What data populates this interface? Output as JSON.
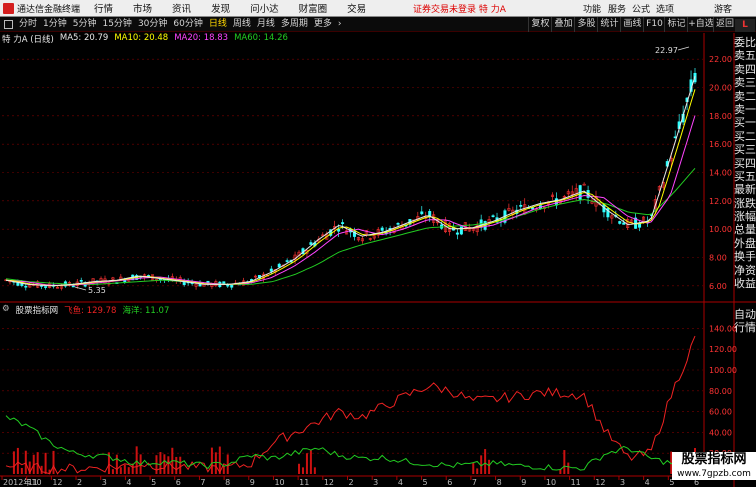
{
  "menubar": {
    "app_name": "通达信金融终端",
    "menus": [
      "行情",
      "市场",
      "资讯",
      "发现",
      "问小达",
      "财富圈",
      "交易"
    ],
    "notice": "证券交易未登录  特 力A",
    "right": [
      "功能",
      "服务",
      "公式",
      "选项",
      "游客"
    ]
  },
  "toolbar": {
    "periods": [
      "分时",
      "1分钟",
      "5分钟",
      "15分钟",
      "30分钟",
      "60分钟",
      "日线",
      "周线",
      "月线",
      "多周期",
      "更多"
    ],
    "selected": "日线",
    "right_buttons": [
      "复权",
      "叠加",
      "多股",
      "统计",
      "画线",
      "F10",
      "标记",
      "+自选",
      "返回"
    ]
  },
  "main_indicator": {
    "title": "特 力A (日线)",
    "ma": [
      {
        "label": "MA5: 20.79",
        "color": "#e8e8e8"
      },
      {
        "label": "MA10: 20.48",
        "color": "#ffff00"
      },
      {
        "label": "MA20: 18.83",
        "color": "#ff44ff"
      },
      {
        "label": "MA60: 14.26",
        "color": "#22cc22"
      }
    ]
  },
  "sub_indicator": {
    "name": "股票指标网",
    "values": [
      {
        "label": "飞鱼: 129.78",
        "color": "#ee2222"
      },
      {
        "label": "海洋: 11.07",
        "color": "#22cc22"
      }
    ]
  },
  "price_axis": [
    "22.00",
    "20.00",
    "18.00",
    "16.00",
    "14.00",
    "12.00",
    "10.00",
    "8.00",
    "6.00"
  ],
  "price_annotations": {
    "high": "22.97",
    "low": "5.35"
  },
  "sub_axis": [
    "140.00",
    "120.00",
    "100.00",
    "80.00",
    "60.00",
    "40.00",
    "20.00"
  ],
  "date_labels": [
    "2012年10",
    "11",
    "12",
    "2",
    "3",
    "4",
    "5",
    "6",
    "7",
    "8",
    "9",
    "10",
    "11",
    "12",
    "2",
    "3",
    "4",
    "5",
    "6",
    "7",
    "8",
    "9",
    "10",
    "11",
    "12",
    "3",
    "4",
    "5",
    "6"
  ],
  "side_tabs_top": [
    "委比",
    "卖五",
    "卖四",
    "卖三",
    "卖二",
    "卖一",
    "买一",
    "买二",
    "买三",
    "买四",
    "买五",
    "最新",
    "涨跌",
    "涨幅",
    "总量",
    "外盘",
    "换手",
    "净资",
    "收益"
  ],
  "side_tabs_bottom": [
    "自动",
    "行情"
  ],
  "watermark": {
    "title": "股票指标网",
    "url": "www.7gpzb.com"
  },
  "corner_badge": "L",
  "colors": {
    "grid": "#7a0000",
    "up": "#ff3333",
    "down": "#33ffff",
    "ma5": "#e8e8e8",
    "ma10": "#ffff00",
    "ma20": "#ff44ff",
    "ma60": "#22cc22"
  },
  "chart_data": {
    "type": "line",
    "series": [
      {
        "name": "MA5",
        "values": [
          6.4,
          6.1,
          6.0,
          6.1,
          6.3,
          6.4,
          6.7,
          6.5,
          6.3,
          6.1,
          6.1,
          6.3,
          7.0,
          7.9,
          9.2,
          10.3,
          9.5,
          9.8,
          10.4,
          11.0,
          10.0,
          10.1,
          10.6,
          11.3,
          11.8,
          12.1,
          12.7,
          11.4,
          10.3,
          10.6,
          15.6,
          20.8
        ]
      },
      {
        "name": "MA60",
        "values": [
          6.5,
          6.3,
          6.2,
          6.1,
          6.1,
          6.2,
          6.3,
          6.4,
          6.3,
          6.2,
          6.1,
          6.1,
          6.3,
          6.8,
          7.5,
          8.4,
          8.9,
          9.3,
          9.7,
          10.1,
          10.2,
          10.3,
          10.5,
          10.9,
          11.4,
          11.8,
          12.1,
          11.8,
          11.2,
          11.0,
          12.5,
          14.3
        ]
      }
    ],
    "sub_series": [
      {
        "name": "飞鱼",
        "values": [
          8,
          6,
          5,
          5,
          6,
          7,
          10,
          8,
          7,
          6,
          6,
          10,
          30,
          40,
          50,
          60,
          55,
          65,
          75,
          85,
          80,
          70,
          72,
          75,
          78,
          78,
          76,
          40,
          15,
          20,
          80,
          130
        ]
      },
      {
        "name": "海洋",
        "values": [
          55,
          45,
          30,
          20,
          18,
          15,
          10,
          12,
          10,
          8,
          10,
          18,
          15,
          20,
          25,
          18,
          15,
          16,
          12,
          10,
          8,
          9,
          10,
          8,
          7,
          6,
          6,
          20,
          25,
          15,
          10,
          11
        ]
      }
    ],
    "ylim": [
      5,
      23
    ],
    "sub_ylim": [
      0,
      150
    ]
  }
}
